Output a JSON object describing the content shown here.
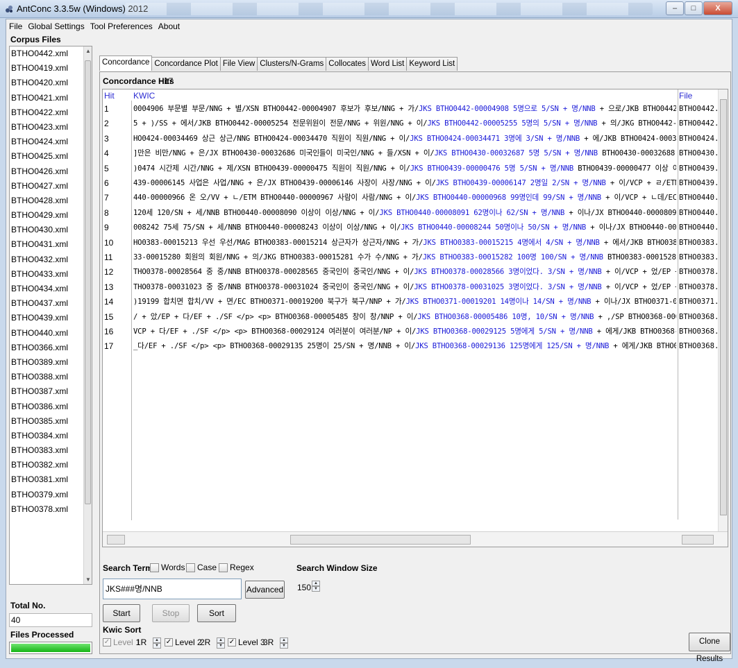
{
  "window": {
    "title": "AntConc 3.3.5w (Windows) 2012",
    "controls": {
      "minimize": "–",
      "maximize": "□",
      "close": "X"
    }
  },
  "menu": [
    "File",
    "Global Settings",
    "Tool Preferences",
    "About"
  ],
  "corpus": {
    "title": "Corpus Files",
    "files": [
      "BTHO0442.xml",
      "BTHO0419.xml",
      "BTHO0420.xml",
      "BTHO0421.xml",
      "BTHO0422.xml",
      "BTHO0423.xml",
      "BTHO0424.xml",
      "BTHO0425.xml",
      "BTHO0426.xml",
      "BTHO0427.xml",
      "BTHO0428.xml",
      "BTHO0429.xml",
      "BTHO0430.xml",
      "BTHO0431.xml",
      "BTHO0432.xml",
      "BTHO0433.xml",
      "BTHO0434.xml",
      "BTHO0437.xml",
      "BTHO0439.xml",
      "BTHO0440.xml",
      "BTHO0366.xml",
      "BTHO0389.xml",
      "BTHO0388.xml",
      "BTHO0387.xml",
      "BTHO0386.xml",
      "BTHO0385.xml",
      "BTHO0384.xml",
      "BTHO0383.xml",
      "BTHO0382.xml",
      "BTHO0381.xml",
      "BTHO0379.xml",
      "BTHO0378.xml"
    ],
    "total_label": "Total No.",
    "total_value": "40",
    "processed_label": "Files Processed",
    "progress": 1.0
  },
  "tabs": [
    "Concordance",
    "Concordance Plot",
    "File View",
    "Clusters/N-Grams",
    "Collocates",
    "Word List",
    "Keyword List"
  ],
  "concordance": {
    "hits_label": "Concordance Hits",
    "hits_count": "17",
    "col_hit": "Hit",
    "col_kwic": "KWIC",
    "col_file": "File",
    "rows": [
      {
        "hit": "1",
        "left": "0004906 부문별 부문/NNG + 별/XSN BTHO0442-00004907 후보가 후보/NNG + 가/",
        "key": "JKS BTHO0442-00004908 5명으로 5/SN + 명/NNB",
        "right": " + 으로/JKB BTHO0442-0",
        "file": "BTHO0442.xml"
      },
      {
        "hit": "2",
        "left": "5 + )/SS + 에서/JKB BTHO0442-00005254 전문위원이 전문/NNG + 위원/NNG + 이/",
        "key": "JKS BTHO0442-00005255 5명의 5/SN + 명/NNB",
        "right": " + 의/JKG BTHO0442-000",
        "file": "BTHO0442.xml"
      },
      {
        "hit": "3",
        "left": "HO0424-00034469 상근 상근/NNG BTHO0424-00034470 직원이 직원/NNG + 이/",
        "key": "JKS BTHO0424-00034471 3명에 3/SN + 명/NNB",
        "right": " + 에/JKB BTHO0424-000344",
        "file": "BTHO0424.xml"
      },
      {
        "hit": "4",
        "left": "]만은 비만/NNG + 은/JX BTHO0430-00032686 미국인들이 미국인/NNG + 들/XSN + 이/",
        "key": "JKS BTHO0430-00032687 5명 5/SN + 명/NNB",
        "right": " BTHO0430-00032688 중",
        "file": "BTHO0430.xml"
      },
      {
        "hit": "5",
        "left": ")0474 시간제 시간/NNG + 제/XSN BTHO0439-00000475 직원이 직원/NNG + 이/",
        "key": "JKS BTHO0439-00000476 5명 5/SN + 명/NNB",
        "right": " BTHO0439-00000477 이상 이상/",
        "file": "BTHO0439.xml"
      },
      {
        "hit": "6",
        "left": "439-00006145 사업은 사업/NNG + 은/JX BTHO0439-00006146 사장이 사장/NNG + 이/",
        "key": "JKS BTHO0439-00006147 2명일 2/SN + 명/NNB",
        "right": " + 이/VCP + ㄹ/ETM BT",
        "file": "BTHO0439.xml"
      },
      {
        "hit": "7",
        "left": "440-00000966 온 오/VV + ㄴ/ETM BTHO0440-00000967 사람이 사람/NNG + 이/",
        "key": "JKS BTHO0440-00000968 99명인데 99/SN + 명/NNB",
        "right": " + 이/VCP + ㄴ데/EC BT",
        "file": "BTHO0440.xml"
      },
      {
        "hit": "8",
        "left": " 120세 120/SN + 세/NNB BTHO0440-00008090 이상이 이상/NNG + 이/",
        "key": "JKS BTHO0440-00008091 62명이나 62/SN + 명/NNB",
        "right": " + 이나/JX BTHO0440-00008092",
        "file": "BTHO0440.xml"
      },
      {
        "hit": "9",
        "left": "008242 75세 75/SN + 세/NNB BTHO0440-00008243 이상이 이상/NNG + 이/",
        "key": "JKS BTHO0440-00008244 50명이나 50/SN + 명/NNB",
        "right": " + 이나/JX BTHO0440-000082",
        "file": "BTHO0440.xml"
      },
      {
        "hit": "10",
        "left": "HO0383-00015213 우선 우선/MAG BTHO0383-00015214 상근자가 상근자/NNG + 가/",
        "key": "JKS BTHO0383-00015215 4명에서 4/SN + 명/NNB",
        "right": " + 에서/JKB BTHO0383-",
        "file": "BTHO0383.xml"
      },
      {
        "hit": "11",
        "left": "33-00015280 회원의 회원/NNG + 의/JKG BTHO0383-00015281 수가 수/NNG + 가/",
        "key": "JKS BTHO0383-00015282 100명 100/SN + 명/NNB",
        "right": " BTHO0383-00015283 미",
        "file": "BTHO0383.xml"
      },
      {
        "hit": "12",
        "left": "THO0378-00028564 중 중/NNB BTHO0378-00028565 중국인이 중국인/NNG + 이/",
        "key": "JKS BTHO0378-00028566 3명이었다. 3/SN + 명/NNB",
        "right": " + 이/VCP + 었/EP + ㄷ",
        "file": "BTHO0378.xml"
      },
      {
        "hit": "13",
        "left": "THO0378-00031023 중 중/NNB BTHO0378-00031024 중국인이 중국인/NNG + 이/",
        "key": "JKS BTHO0378-00031025 3명이었다. 3/SN + 명/NNB",
        "right": " + 이/VCP + 었/EP + ㄷ",
        "file": "BTHO0378.xml"
      },
      {
        "hit": "14",
        "left": ")19199 합치면 합치/VV + 면/EC BTHO0371-00019200 북구가 북구/NNP + 가/",
        "key": "JKS BTHO0371-00019201 14명이나 14/SN + 명/NNB",
        "right": " + 이나/JX BTHO0371-0001",
        "file": "BTHO0371.xml"
      },
      {
        "hit": "15",
        "left": "/ + 았/EP + 다/EF + ./SF </p> <p> BTHO0368-00005485 창이 창/NNP + 이/",
        "key": "JKS BTHO0368-00005486 10명, 10/SN + 명/NNB",
        "right": " + ,/SP BTHO0368-00005487",
        "file": "BTHO0368.xml"
      },
      {
        "hit": "16",
        "left": "VCP + 다/EF + ./SF </p> <p> BTHO0368-00029124 여러분이 여러분/NP + 이/",
        "key": "JKS BTHO0368-00029125 5명에게 5/SN + 명/NNB",
        "right": " + 에게/JKB BTHO0368-000",
        "file": "BTHO0368.xml"
      },
      {
        "hit": "17",
        "left": "_다/EF + ./SF </p> <p> BTHO0368-00029135 25명이 25/SN + 명/NNB + 이/",
        "key": "JKS BTHO0368-00029136 125명에게 125/SN + 명/NNB",
        "right": " + 에게/JKB BTHO0368-",
        "file": "BTHO0368.xml"
      }
    ]
  },
  "search": {
    "term_label": "Search Term",
    "words_label": "Words",
    "case_label": "Case",
    "regex_label": "Regex",
    "value": "JKS###명/NNB",
    "advanced_label": "Advanced",
    "window_label": "Search Window Size",
    "window_value": "150",
    "start_label": "Start",
    "stop_label": "Stop",
    "sort_label": "Sort"
  },
  "kwic_sort": {
    "title": "Kwic Sort",
    "levels": [
      {
        "label": "Level 1",
        "value": "1R"
      },
      {
        "label": "Level 2",
        "value": "2R"
      },
      {
        "label": "Level 3",
        "value": "3R"
      }
    ],
    "clone_label": "Clone Results"
  },
  "colors": {
    "key_blue": "#1a1ad8",
    "header_blue": "#2b2bd2",
    "progress_green": "#15b515"
  }
}
